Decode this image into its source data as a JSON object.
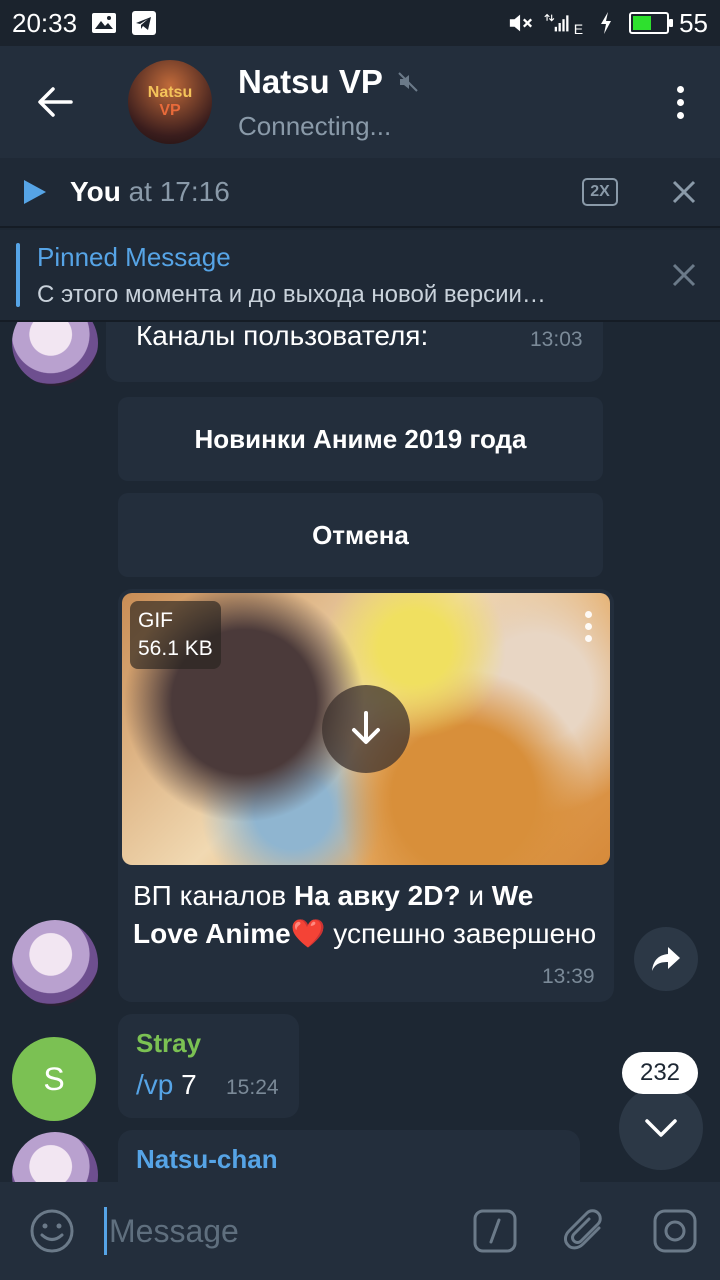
{
  "status_bar": {
    "time": "20:33",
    "network_label": "E",
    "battery_level": "55",
    "battery_fraction": 0.55
  },
  "header": {
    "channel_avatar_text_line1": "Natsu",
    "channel_avatar_text_line2": "VP",
    "title": "Natsu VP",
    "status": "Connecting..."
  },
  "player": {
    "author": "You",
    "time_text": "at 17:16",
    "speed": "2X"
  },
  "pinned": {
    "title": "Pinned Message",
    "text": "С этого момента и до выхода новой версии…"
  },
  "messages": {
    "first": {
      "text": "Каналы пользователя:",
      "time": "13:03"
    },
    "keyboard_buttons": [
      "Новинки Аниме 2019 года",
      "Отмена"
    ],
    "gif": {
      "type_label": "GIF",
      "size": "56.1 KB",
      "caption_part1": "ВП каналов ",
      "caption_bold1": "На авку 2D?",
      "caption_part2": " и ",
      "caption_bold2": "We Love Anime❤️",
      "caption_part3": " успешно завершено",
      "time": "13:39"
    },
    "stray": {
      "avatar_letter": "S",
      "sender": "Stray",
      "command": "/vp",
      "arg": " 7",
      "time": "15:24"
    },
    "natsu": {
      "sender": "Natsu-chan"
    },
    "unread_count": "232"
  },
  "input": {
    "placeholder": "Message"
  },
  "colors": {
    "accent": "#56a4e6",
    "stray_name": "#7bc153",
    "background": "#1d2733",
    "bubble": "#232e3c"
  }
}
